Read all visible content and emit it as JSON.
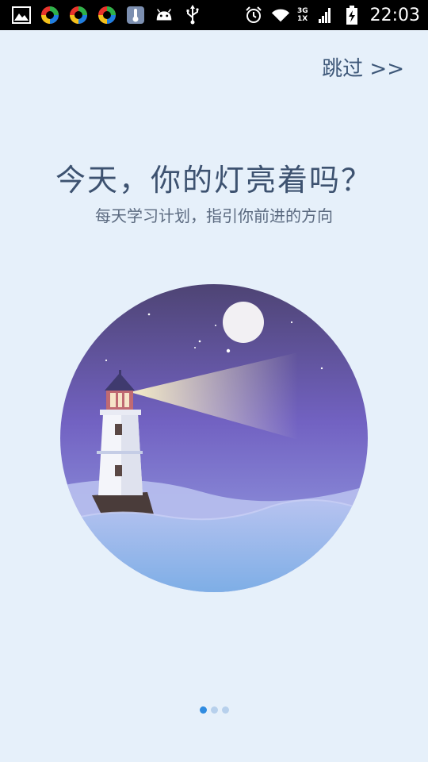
{
  "status_bar": {
    "time": "22:03",
    "network_top": "3G",
    "network_bottom": "1X",
    "left_icons": [
      "gallery-icon",
      "app-icon",
      "app-icon",
      "app-icon",
      "thermometer-icon",
      "android-icon",
      "usb-icon"
    ],
    "right_icons": [
      "alarm-icon",
      "wifi-icon",
      "signal-icon",
      "battery-icon"
    ]
  },
  "skip_label": "跳过 >>",
  "title": "今天，你的灯亮着吗？",
  "subtitle": "每天学习计划，指引你前进的方向",
  "pager": {
    "count": 3,
    "active_index": 0
  },
  "colors": {
    "background": "#e6f0fa",
    "title": "#3d5270",
    "dot_active": "#2f8be0",
    "dot_inactive": "#b7d0ec"
  }
}
